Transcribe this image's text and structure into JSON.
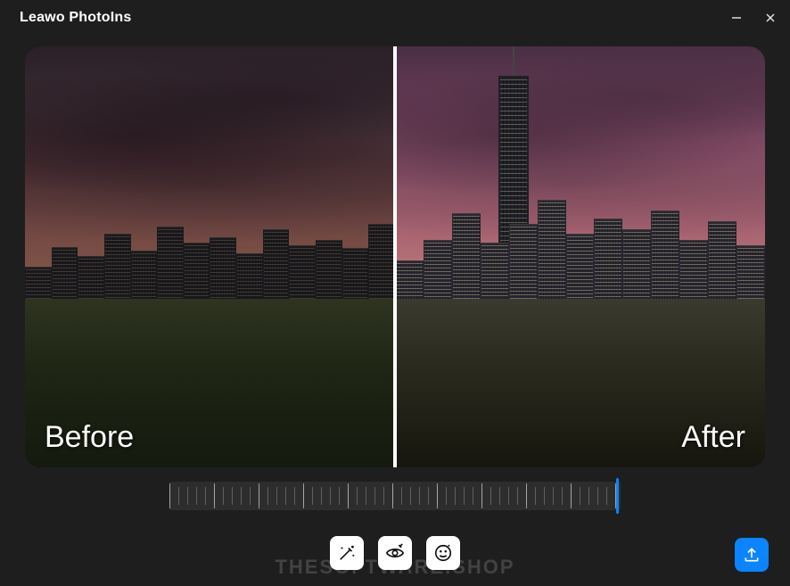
{
  "app": {
    "title": "Leawo PhotoIns"
  },
  "preview": {
    "before_label": "Before",
    "after_label": "After",
    "divider_position_pct": 50
  },
  "slider": {
    "value_pct": 99
  },
  "toolbar": {
    "enhance_icon": "magic-wand-icon",
    "eye_icon": "eye-enhance-icon",
    "face_icon": "face-enhance-icon",
    "export_icon": "export-icon"
  },
  "colors": {
    "accent": "#0a84ff",
    "bg": "#1e1e1e"
  },
  "watermark": "THESOFTWARE.SHOP"
}
